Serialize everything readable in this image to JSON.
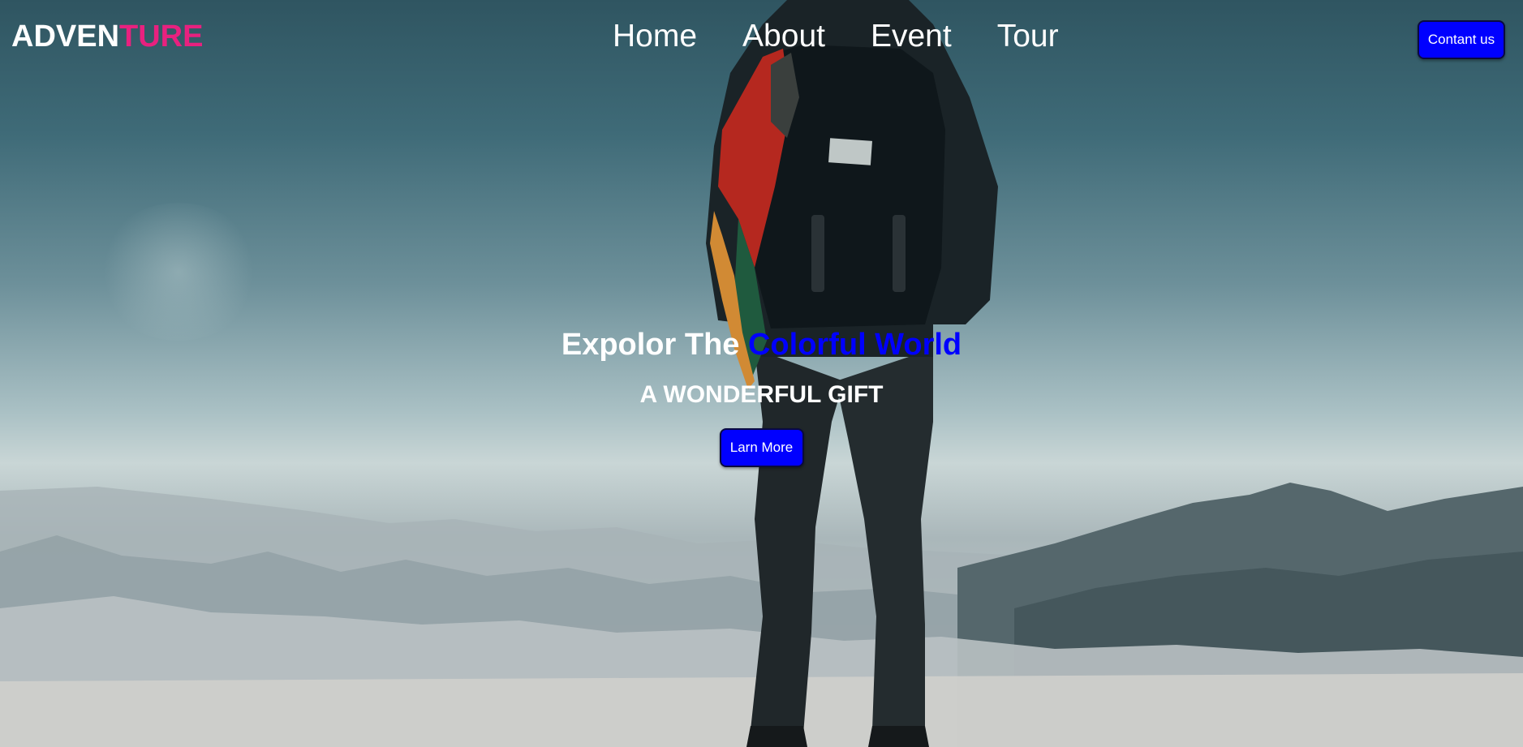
{
  "brand": {
    "logo_part1": "ADVEN",
    "logo_part2": "TURE"
  },
  "nav": {
    "items": [
      {
        "label": "Home"
      },
      {
        "label": "About"
      },
      {
        "label": "Event"
      },
      {
        "label": "Tour"
      }
    ],
    "contact_label": "Contant us"
  },
  "hero": {
    "headline_part1": "Expolor The ",
    "headline_accent": "Colorful World",
    "subheadline": "A WONDERFUL GIFT",
    "cta_label": "Larn More"
  },
  "colors": {
    "accent_blue": "#0000ff",
    "brand_pink": "#e8217f",
    "text_white": "#ffffff"
  }
}
